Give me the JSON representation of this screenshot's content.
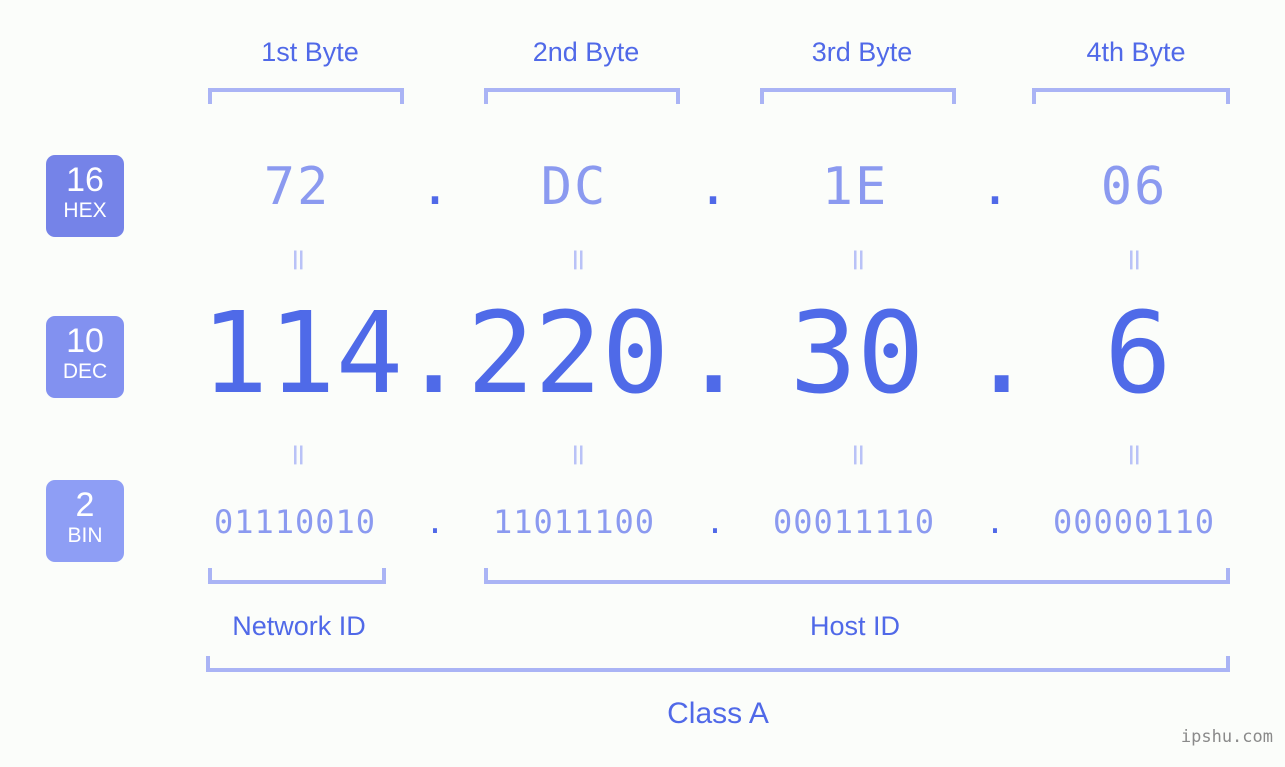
{
  "watermark": "ipshu.com",
  "colors": {
    "background": "#fbfdfa",
    "accent_strong": "#5069e8",
    "accent_light": "#8b9af0",
    "bracket": "#aab4f5",
    "eq_mark": "#b9c2f7",
    "badge_hex": "#7583e8",
    "badge_dec": "#8291f0",
    "badge_bin": "#8e9ef5",
    "watermark": "#8a8a8a"
  },
  "byte_headers": [
    {
      "label": "1st Byte"
    },
    {
      "label": "2nd Byte"
    },
    {
      "label": "3rd Byte"
    },
    {
      "label": "4th Byte"
    }
  ],
  "bases": [
    {
      "num": "16",
      "abbr": "HEX"
    },
    {
      "num": "10",
      "abbr": "DEC"
    },
    {
      "num": "2",
      "abbr": "BIN"
    }
  ],
  "separator": ".",
  "equals_mark": "=",
  "rows": {
    "hex": {
      "values": [
        "72",
        "DC",
        "1E",
        "06"
      ]
    },
    "dec": {
      "values": [
        "114",
        "220",
        "30",
        "6"
      ]
    },
    "bin": {
      "values": [
        "01110010",
        "11011100",
        "00011110",
        "00000110"
      ]
    }
  },
  "segments": {
    "network_id": "Network ID",
    "host_id": "Host ID"
  },
  "ip_class": "Class A"
}
